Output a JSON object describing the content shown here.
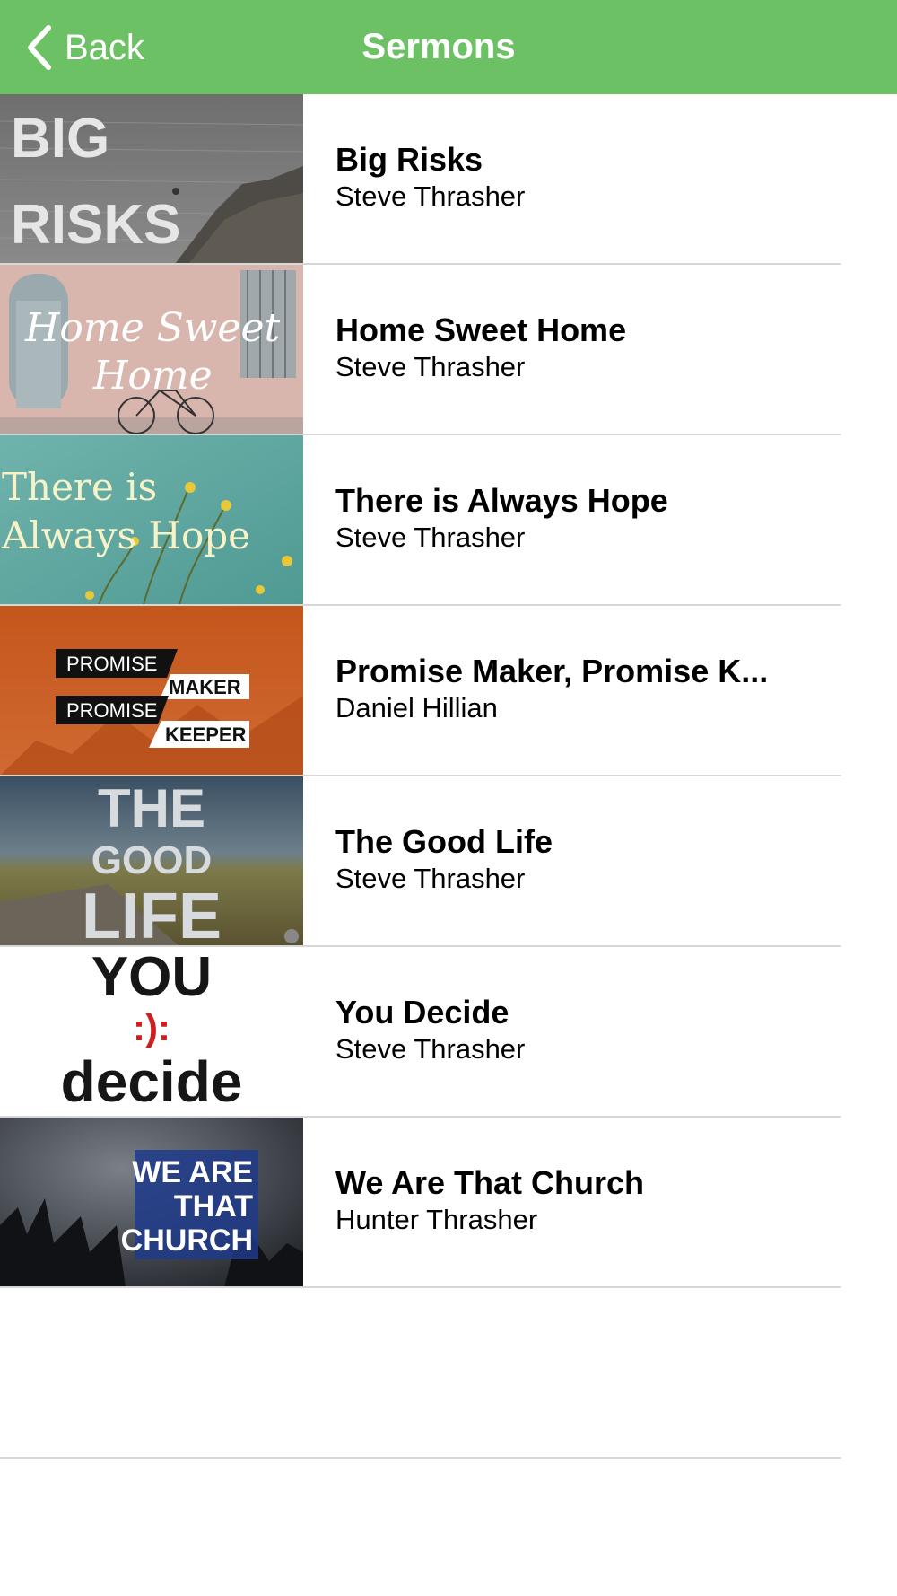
{
  "header": {
    "back_label": "Back",
    "title": "Sermons",
    "color": "#6cc164"
  },
  "sermons": [
    {
      "title": "Big Risks",
      "speaker": "Steve Thrasher",
      "art_text": [
        "BIG",
        "RISKS"
      ]
    },
    {
      "title": "Home Sweet Home",
      "speaker": "Steve Thrasher",
      "art_text": [
        "Home Sweet",
        "Home"
      ]
    },
    {
      "title": "There is Always Hope",
      "speaker": "Steve Thrasher",
      "art_text": [
        "There is",
        "Always Hope"
      ]
    },
    {
      "title": "Promise Maker, Promise K...",
      "speaker": "Daniel Hillian",
      "art_text": [
        "PROMISE",
        "MAKER",
        "PROMISE",
        "KEEPER"
      ]
    },
    {
      "title": "The Good Life",
      "speaker": "Steve Thrasher",
      "art_text": [
        "THE",
        "GOOD",
        "LIFE"
      ]
    },
    {
      "title": "You Decide",
      "speaker": "Steve Thrasher",
      "art_text": [
        "YOU",
        ":):",
        "decide"
      ]
    },
    {
      "title": "We Are That Church",
      "speaker": "Hunter Thrasher",
      "art_text": [
        "WE ARE",
        "THAT",
        "CHURCH"
      ]
    }
  ]
}
